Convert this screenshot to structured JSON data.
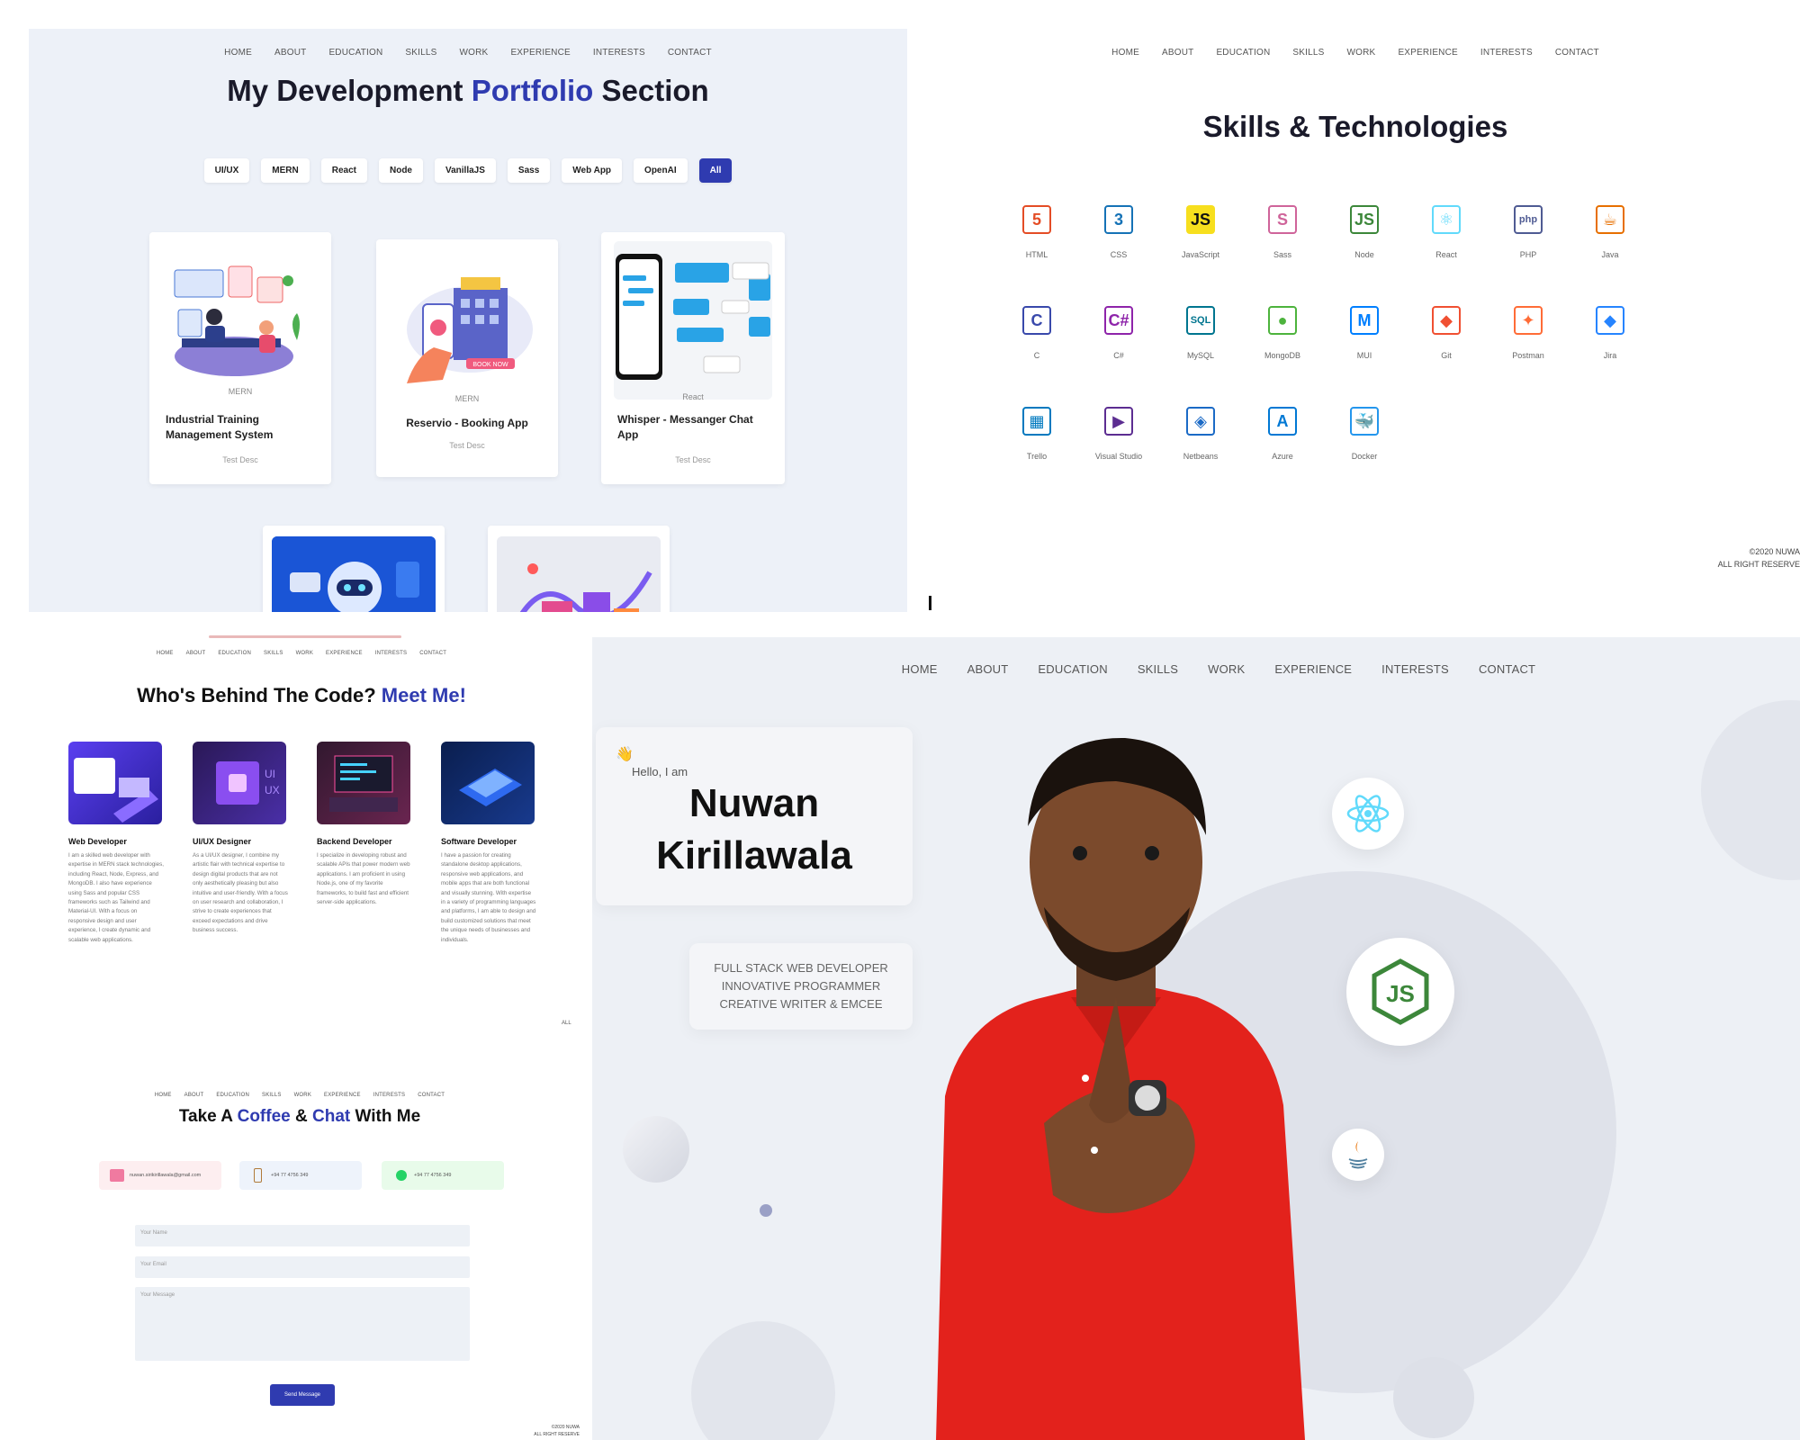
{
  "portfolio": {
    "nav": [
      "HOME",
      "ABOUT",
      "EDUCATION",
      "SKILLS",
      "WORK",
      "EXPERIENCE",
      "INTERESTS",
      "CONTACT"
    ],
    "title_a": "My Development ",
    "title_b": "Portfolio",
    "title_c": " Section",
    "filters": [
      "UI/UX",
      "MERN",
      "React",
      "Node",
      "VanillaJS",
      "Sass",
      "Web App",
      "OpenAI",
      "All"
    ],
    "cards": [
      {
        "tag": "MERN",
        "title": "Industrial Training Management System",
        "desc": "Test Desc"
      },
      {
        "tag": "MERN",
        "title": "Reservio - Booking App",
        "desc": "Test Desc"
      },
      {
        "tag": "React",
        "title": "Whisper - Messanger Chat App",
        "desc": "Test Desc"
      }
    ],
    "booking_badge": "BOOK NOW"
  },
  "skills": {
    "nav": [
      "HOME",
      "ABOUT",
      "EDUCATION",
      "SKILLS",
      "WORK",
      "EXPERIENCE",
      "INTERESTS",
      "CONTACT"
    ],
    "title": "Skills & Technologies",
    "items": [
      {
        "label": "HTML",
        "icon": "html5-icon",
        "color": "#e44d26"
      },
      {
        "label": "CSS",
        "icon": "css3-icon",
        "color": "#1572b6"
      },
      {
        "label": "JavaScript",
        "icon": "javascript-icon",
        "color": "#f7df1e"
      },
      {
        "label": "Sass",
        "icon": "sass-icon",
        "color": "#cf649a"
      },
      {
        "label": "Node",
        "icon": "nodejs-icon",
        "color": "#3c873a"
      },
      {
        "label": "React",
        "icon": "react-icon",
        "color": "#61dafb"
      },
      {
        "label": "PHP",
        "icon": "php-icon",
        "color": "#4f5b93"
      },
      {
        "label": "Java",
        "icon": "java-icon",
        "color": "#e76f00"
      },
      {
        "label": "C",
        "icon": "c-icon",
        "color": "#3949ab"
      },
      {
        "label": "C#",
        "icon": "csharp-icon",
        "color": "#8e24aa"
      },
      {
        "label": "MySQL",
        "icon": "mysql-icon",
        "color": "#00758f"
      },
      {
        "label": "MongoDB",
        "icon": "mongodb-icon",
        "color": "#4db33d"
      },
      {
        "label": "MUI",
        "icon": "mui-icon",
        "color": "#007fff"
      },
      {
        "label": "Git",
        "icon": "git-icon",
        "color": "#f05032"
      },
      {
        "label": "Postman",
        "icon": "postman-icon",
        "color": "#ff6c37"
      },
      {
        "label": "Jira",
        "icon": "jira-icon",
        "color": "#2684ff"
      },
      {
        "label": "Trello",
        "icon": "trello-icon",
        "color": "#0079bf"
      },
      {
        "label": "Visual Studio",
        "icon": "visual-studio-icon",
        "color": "#5c2d91"
      },
      {
        "label": "Netbeans",
        "icon": "netbeans-icon",
        "color": "#1b6ac6"
      },
      {
        "label": "Azure",
        "icon": "azure-icon",
        "color": "#0078d4"
      },
      {
        "label": "Docker",
        "icon": "docker-icon",
        "color": "#2496ed"
      }
    ],
    "footer1": "©2020 NUWA",
    "footer2": "ALL RIGHT RESERVE"
  },
  "about": {
    "nav": [
      "HOME",
      "ABOUT",
      "EDUCATION",
      "SKILLS",
      "WORK",
      "EXPERIENCE",
      "INTERESTS",
      "CONTACT"
    ],
    "title_a": "Who's Behind The Code? ",
    "title_b": "Meet Me!",
    "roles": [
      {
        "title": "Web Developer",
        "desc": "I am a skilled web developer with expertise in MERN stack technologies, including React, Node, Express, and MongoDB. I also have experience using Sass and popular CSS frameworks such as Tailwind and Material-UI. With a focus on responsive design and user experience, I create dynamic and scalable web applications."
      },
      {
        "title": "UI/UX Designer",
        "desc": "As a UI/UX designer, I combine my artistic flair with technical expertise to design digital products that are not only aesthetically pleasing but also intuitive and user-friendly. With a focus on user research and collaboration, I strive to create experiences that exceed expectations and drive business success."
      },
      {
        "title": "Backend Developer",
        "desc": "I specialize in developing robust and scalable APIs that power modern web applications. I am proficient in using Node.js, one of my favorite frameworks, to build fast and efficient server-side applications."
      },
      {
        "title": "Software Developer",
        "desc": "I have a passion for creating standalone desktop applications, responsive web applications, and mobile apps that are both functional and visually stunning. With expertise in a variety of programming languages and platforms, I am able to design and build customized solutions that meet the unique needs of businesses and individuals."
      }
    ],
    "all_label": "ALL"
  },
  "contact": {
    "nav": [
      "HOME",
      "ABOUT",
      "EDUCATION",
      "SKILLS",
      "WORK",
      "EXPERIENCE",
      "INTERESTS",
      "CONTACT"
    ],
    "title_a": "Take A ",
    "title_b": "Coffee",
    "title_c": " & ",
    "title_d": "Chat",
    "title_e": " With Me",
    "email": "nuwan.sirikirillawala@gmail.com",
    "phone": "+94 77 4756 349",
    "whatsapp": "+94 77 4756 349",
    "name_ph": "Your Name",
    "email_ph": "Your Email",
    "msg_ph": "Your Message",
    "send": "Send Message",
    "footer1": "©2020 NUWA",
    "footer2": "ALL RIGHT RESERVE"
  },
  "hero": {
    "nav": [
      "HOME",
      "ABOUT",
      "EDUCATION",
      "SKILLS",
      "WORK",
      "EXPERIENCE",
      "INTERESTS",
      "CONTACT"
    ],
    "greeting": "Hello, I am",
    "first": "Nuwan",
    "last": "Kirillawala",
    "lines": [
      "FULL STACK WEB DEVELOPER",
      "INNOVATIVE PROGRAMMER",
      "CREATIVE WRITER & EMCEE"
    ]
  }
}
